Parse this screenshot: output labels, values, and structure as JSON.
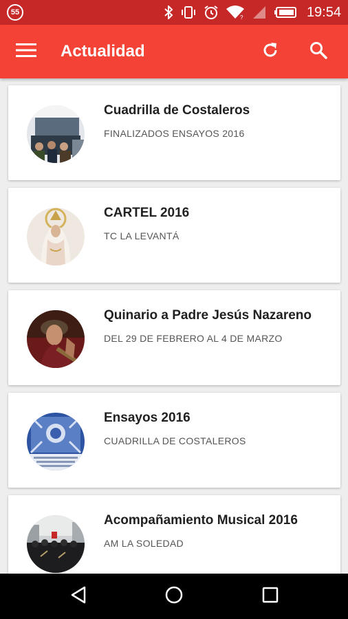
{
  "status_bar": {
    "notification_badge": "55",
    "time": "19:54",
    "icons": [
      "bluetooth-icon",
      "vibrate-icon",
      "alarm-icon",
      "wifi-icon",
      "signal-icon",
      "battery-icon"
    ]
  },
  "app_bar": {
    "title": "Actualidad",
    "color": "#f44336",
    "menu_icon": "hamburger-menu-icon",
    "refresh_icon": "refresh-icon",
    "search_icon": "search-icon"
  },
  "news": [
    {
      "title": "Cuadrilla de Costaleros",
      "subtitle": "FINALIZADOS ENSAYOS 2016"
    },
    {
      "title": "CARTEL 2016",
      "subtitle": "TC LA LEVANTÁ"
    },
    {
      "title": "Quinario a Padre Jesús Nazareno",
      "subtitle": "DEL 29 DE FEBRERO AL 4 DE MARZO"
    },
    {
      "title": "Ensayos 2016",
      "subtitle": "CUADRILLA DE COSTALEROS"
    },
    {
      "title": "Acompañamiento Musical 2016",
      "subtitle": "AM LA SOLEDAD"
    }
  ],
  "nav_bar": {
    "icons": [
      "back-icon",
      "home-icon",
      "recents-icon"
    ]
  }
}
